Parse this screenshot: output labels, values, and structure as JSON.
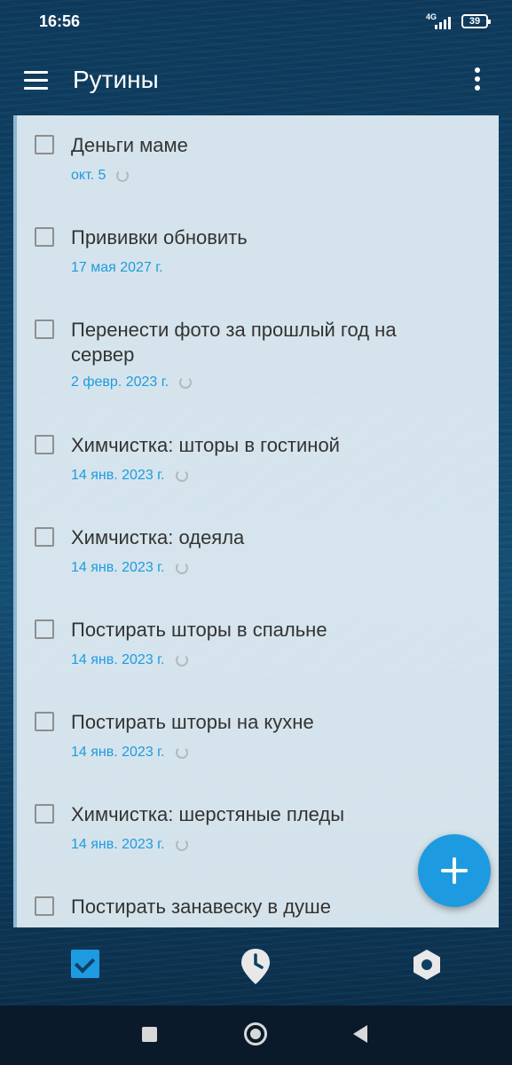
{
  "status_bar": {
    "time": "16:56",
    "network": "4G",
    "battery": "39"
  },
  "app_bar": {
    "title": "Рутины"
  },
  "tasks": [
    {
      "title": "Деньги маме",
      "date": "окт. 5",
      "repeating": true
    },
    {
      "title": "Прививки обновить",
      "date": "17 мая 2027 г.",
      "repeating": false
    },
    {
      "title": "Перенести фото за прошлый год на сервер",
      "date": "2 февр. 2023 г.",
      "repeating": true
    },
    {
      "title": "Химчистка: шторы в гостиной",
      "date": "14 янв. 2023 г.",
      "repeating": true
    },
    {
      "title": "Химчистка: одеяла",
      "date": "14 янв. 2023 г.",
      "repeating": true
    },
    {
      "title": "Постирать шторы в спальне",
      "date": "14 янв. 2023 г.",
      "repeating": true
    },
    {
      "title": "Постирать шторы на кухне",
      "date": "14 янв. 2023 г.",
      "repeating": true
    },
    {
      "title": "Химчистка: шерстяные пледы",
      "date": "14 янв. 2023 г.",
      "repeating": true
    },
    {
      "title": "Постирать занавеску в душе",
      "date": "",
      "repeating": false
    }
  ],
  "colors": {
    "accent": "#1e9be0",
    "title_text": "#333333",
    "panel_bg": "#e4f0f6"
  },
  "bottom_nav": {
    "items": [
      {
        "icon": "checkbox-icon",
        "active": true
      },
      {
        "icon": "clock-pin-icon",
        "active": false
      },
      {
        "icon": "settings-hex-icon",
        "active": false
      }
    ]
  }
}
